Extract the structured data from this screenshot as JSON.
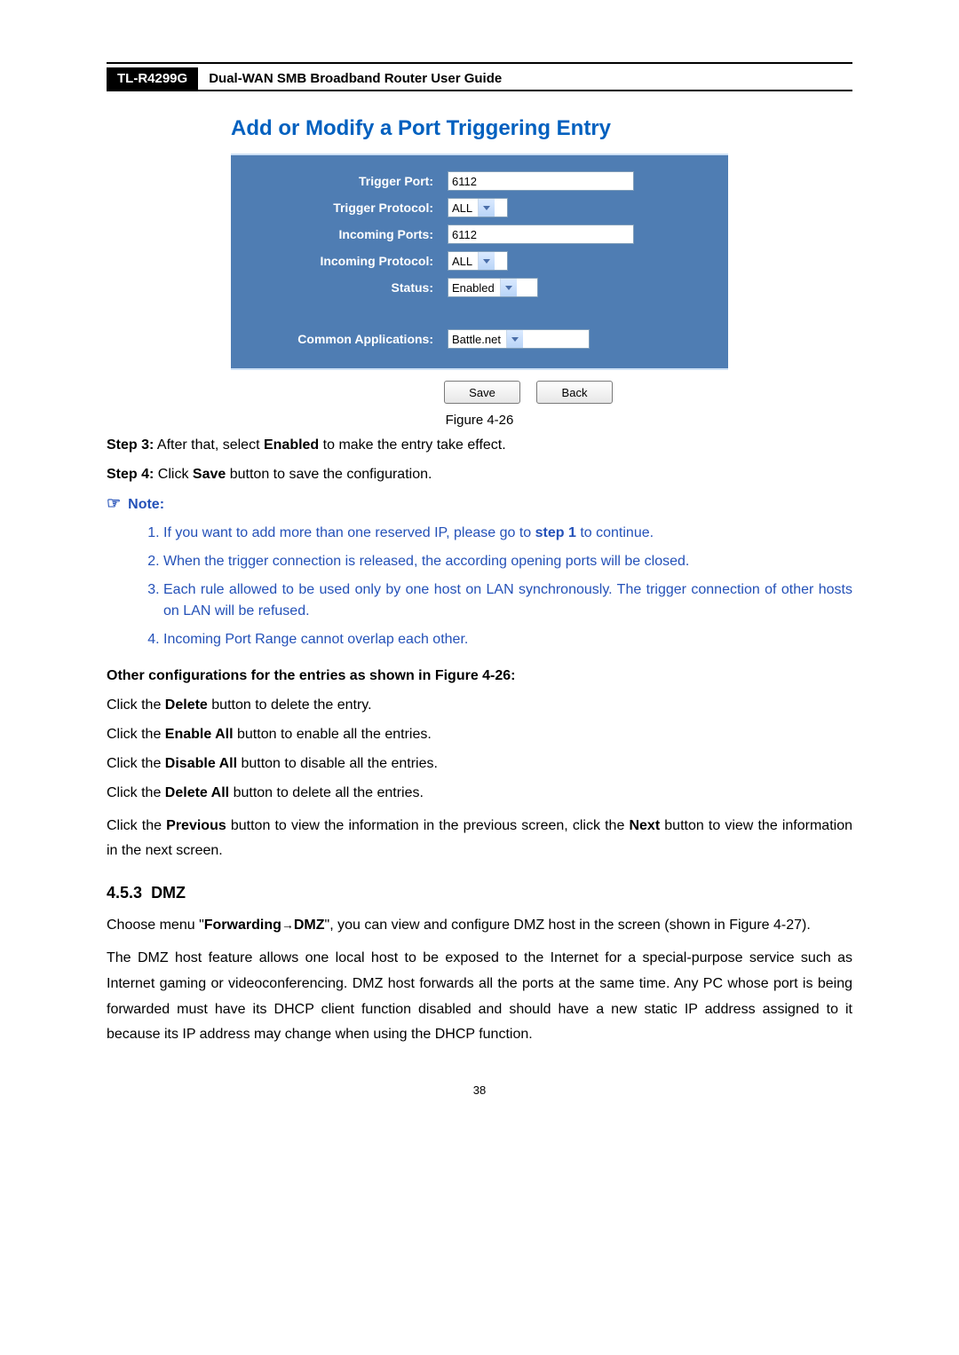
{
  "header": {
    "model": "TL-R4299G",
    "title": "Dual-WAN SMB Broadband Router User Guide"
  },
  "screenshot": {
    "title": "Add or Modify a Port Triggering Entry",
    "fields": {
      "trigger_port": {
        "label": "Trigger Port:",
        "value": "6112"
      },
      "trigger_protocol": {
        "label": "Trigger Protocol:",
        "value": "ALL"
      },
      "incoming_ports": {
        "label": "Incoming Ports:",
        "value": "6112"
      },
      "incoming_protocol": {
        "label": "Incoming Protocol:",
        "value": "ALL"
      },
      "status": {
        "label": "Status:",
        "value": "Enabled"
      },
      "common_apps": {
        "label": "Common Applications:",
        "value": "Battle.net"
      }
    },
    "buttons": {
      "save": "Save",
      "back": "Back"
    }
  },
  "fig_caption": "Figure 4-26",
  "steps": {
    "s3_label": "Step 3:",
    "s3_a": " After that, select ",
    "s3_bold": "Enabled",
    "s3_b": " to make the entry take effect.",
    "s4_label": "Step 4:",
    "s4_a": " Click ",
    "s4_bold": "Save",
    "s4_b": " button to save the configuration."
  },
  "note": {
    "label": "Note:",
    "items": [
      {
        "a": "If you want to add more than one reserved IP, please go to ",
        "bold": "step 1",
        "b": " to continue."
      },
      {
        "a": "When the trigger connection is released, the according opening ports will be closed.",
        "bold": "",
        "b": ""
      },
      {
        "a": "Each rule allowed to be used only by one host on LAN synchronously. The trigger connection of other hosts on LAN will be refused.",
        "bold": "",
        "b": ""
      },
      {
        "a": "Incoming Port Range cannot overlap each other.",
        "bold": "",
        "b": ""
      }
    ]
  },
  "other_cfg": {
    "heading": "Other configurations for the entries as shown in Figure 4-26:",
    "lines": [
      {
        "a": "Click the ",
        "bold": "Delete",
        "b": " button to delete the entry."
      },
      {
        "a": "Click the ",
        "bold": "Enable All",
        "b": " button to enable all the entries."
      },
      {
        "a": "Click the ",
        "bold": "Disable All",
        "b": " button to disable all the entries."
      },
      {
        "a": "Click the ",
        "bold": "Delete All",
        "b": " button to delete all the entries."
      }
    ],
    "prevnext_a": "Click the ",
    "prevnext_b1": "Previous",
    "prevnext_c": " button to view the information in the previous screen, click the ",
    "prevnext_b2": "Next",
    "prevnext_d": " button to view the information in the next screen."
  },
  "section": {
    "num": "4.5.3",
    "title": "DMZ",
    "p1_a": "Choose menu \"",
    "p1_b1": "Forwarding",
    "p1_arrow": "→",
    "p1_b2": "DMZ",
    "p1_b": "\", you can view and configure DMZ host in the screen (shown in Figure 4-27).",
    "p2": "The DMZ host feature allows one local host to be exposed to the Internet for a special-purpose service such as Internet gaming or videoconferencing. DMZ host forwards all the ports at the same time. Any PC whose port is being forwarded must have its DHCP client function disabled and should have a new static IP address assigned to it because its IP address may change when using the DHCP function."
  },
  "page_number": "38"
}
